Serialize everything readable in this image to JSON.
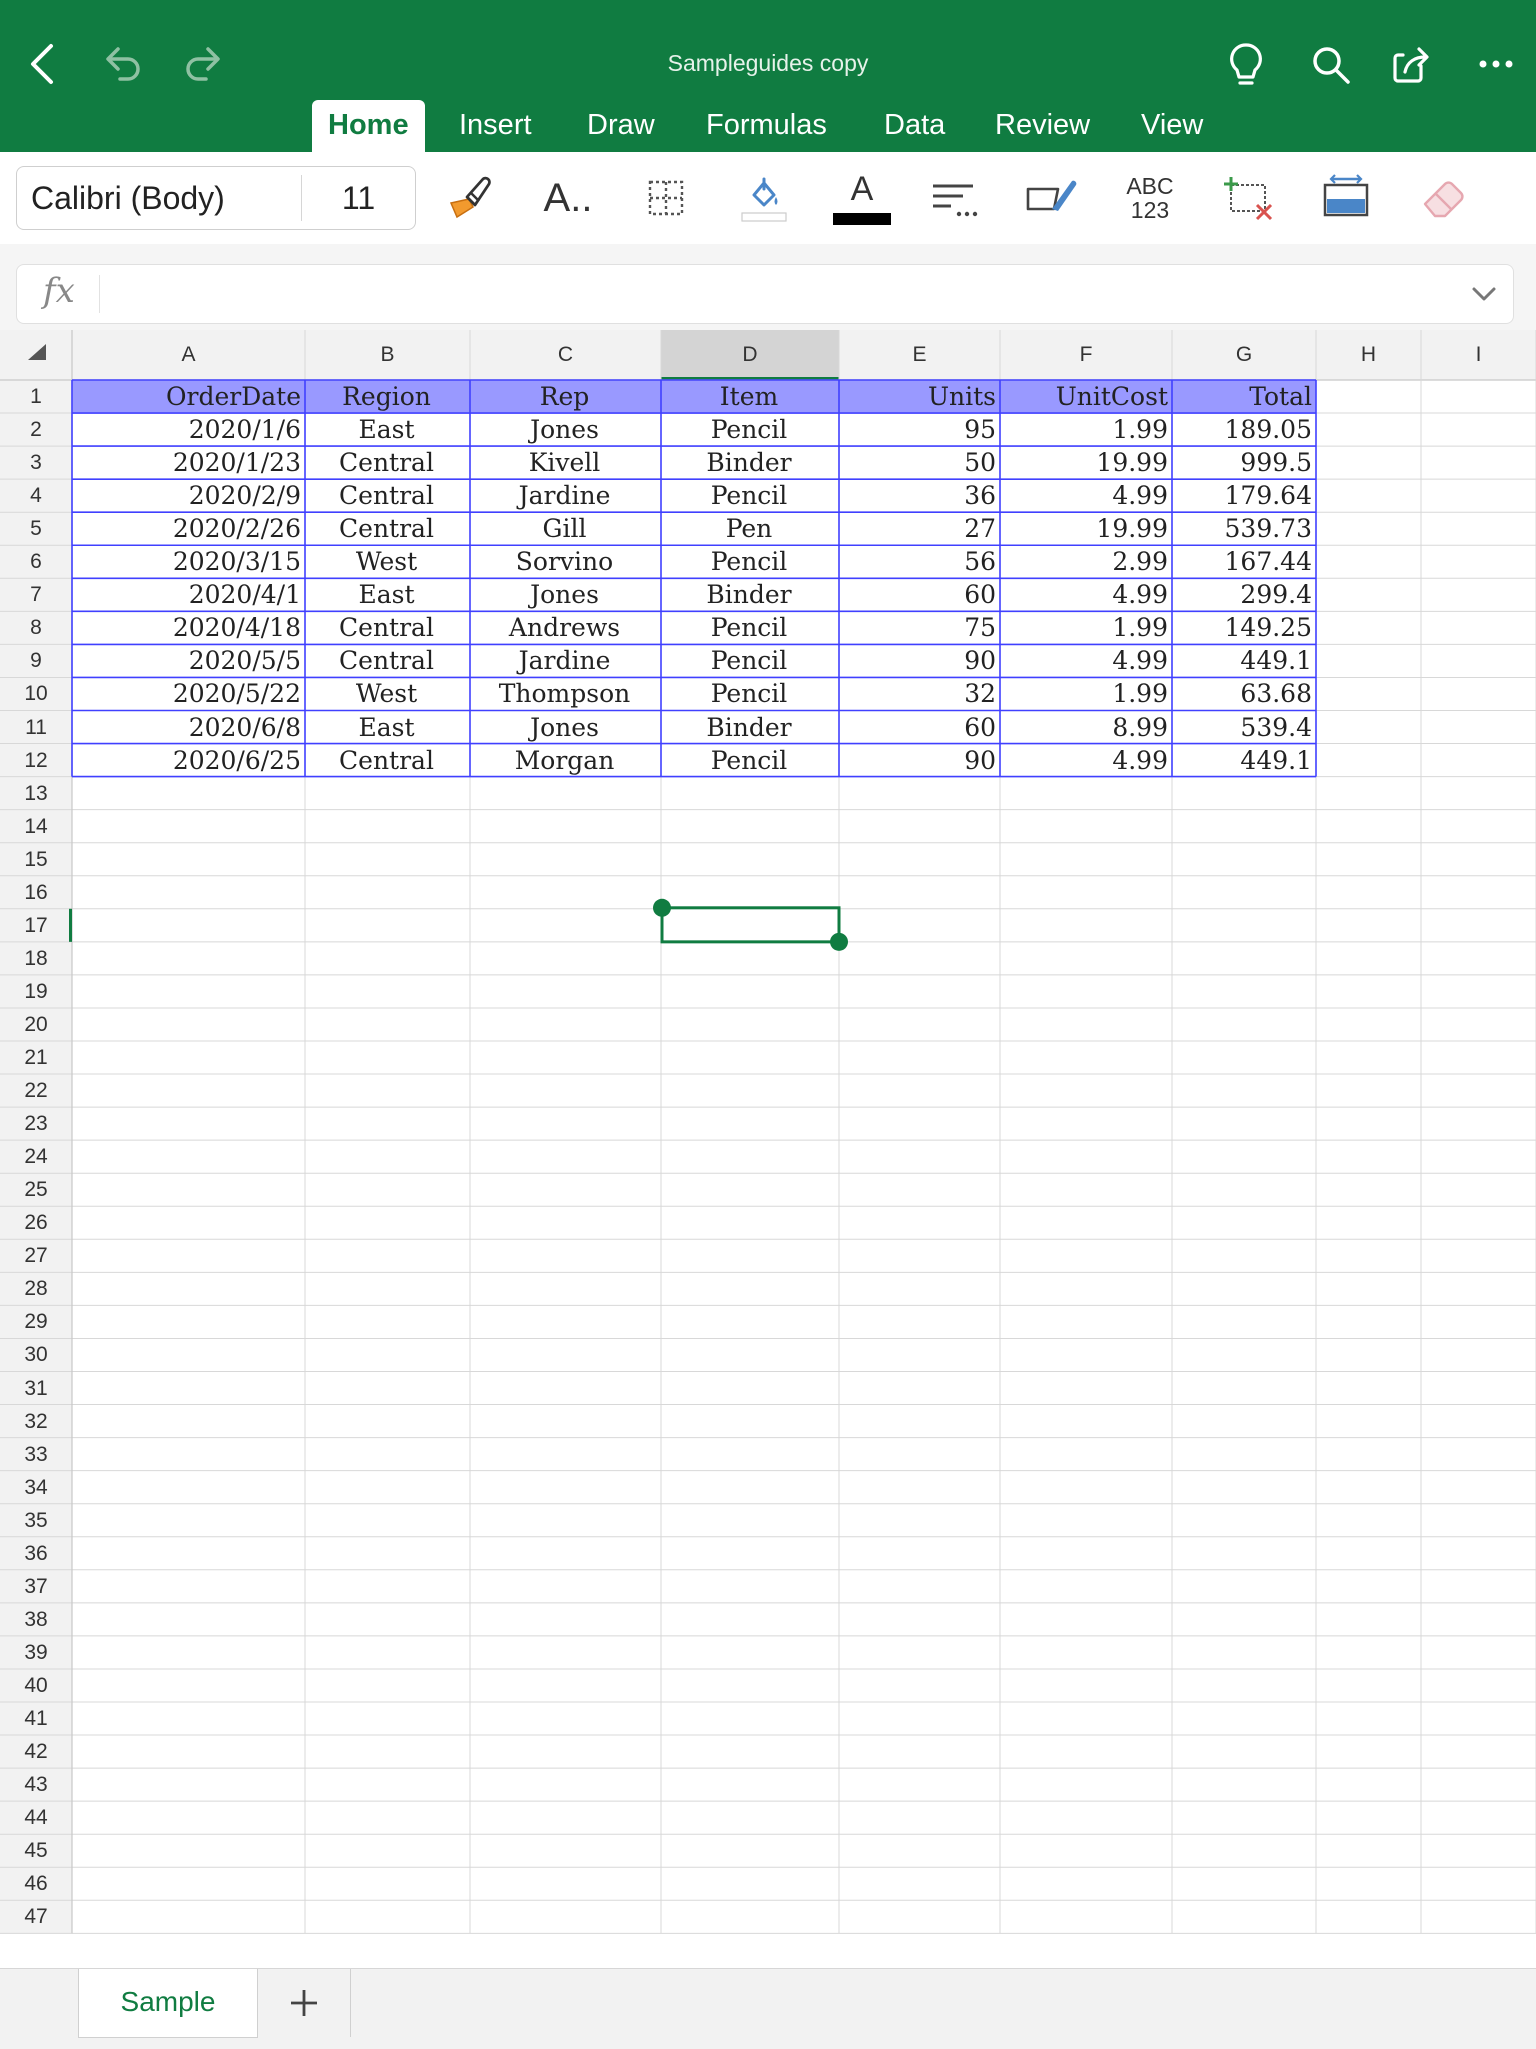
{
  "app": {
    "document_title": "Sampleguides copy",
    "accent_color": "#107c41"
  },
  "toolbar_icons": [
    "back-icon",
    "undo-icon",
    "redo-icon",
    "lightbulb-icon",
    "search-icon",
    "share-icon",
    "more-icon"
  ],
  "tabs": [
    {
      "label": "Home",
      "active": true
    },
    {
      "label": "Insert",
      "active": false
    },
    {
      "label": "Draw",
      "active": false
    },
    {
      "label": "Formulas",
      "active": false
    },
    {
      "label": "Data",
      "active": false
    },
    {
      "label": "Review",
      "active": false
    },
    {
      "label": "View",
      "active": false
    }
  ],
  "ribbon": {
    "font_name": "Calibri (Body)",
    "font_size": "11",
    "number_format_label_top": "ABC",
    "number_format_label_bottom": "123",
    "font_color_glyph": "A",
    "font_style_glyph": "A..",
    "icons": [
      "format-painter-icon",
      "font-style-icon",
      "borders-icon",
      "fill-color-icon",
      "font-color-icon",
      "alignment-icon",
      "cell-styles-icon",
      "number-format-icon",
      "insert-delete-icon",
      "format-cells-icon",
      "clear-icon"
    ]
  },
  "formula_bar": {
    "fx_label": "fx",
    "value": ""
  },
  "grid": {
    "columns": [
      "A",
      "B",
      "C",
      "D",
      "E",
      "F",
      "G",
      "H",
      "I"
    ],
    "row_numbers": [
      "1",
      "2",
      "3",
      "4",
      "5",
      "6",
      "7",
      "8",
      "9",
      "10",
      "11",
      "12",
      "13",
      "14",
      "15",
      "16",
      "17",
      "18",
      "19",
      "20",
      "21",
      "22",
      "23",
      "24",
      "25",
      "26",
      "27",
      "28",
      "29",
      "30",
      "31",
      "32",
      "33",
      "34",
      "35",
      "36",
      "37",
      "38",
      "39",
      "40",
      "41",
      "42",
      "43",
      "44",
      "45",
      "46",
      "47"
    ],
    "selected_column": "D",
    "selected_row": "17",
    "selected_cell": "D17",
    "table_header_color": "#9999ff",
    "table_border_color": "#4040ff",
    "headers": [
      "OrderDate",
      "Region",
      "Rep",
      "Item",
      "Units",
      "UnitCost",
      "Total"
    ],
    "rows": [
      [
        "2020/1/6",
        "East",
        "Jones",
        "Pencil",
        "95",
        "1.99",
        "189.05"
      ],
      [
        "2020/1/23",
        "Central",
        "Kivell",
        "Binder",
        "50",
        "19.99",
        "999.5"
      ],
      [
        "2020/2/9",
        "Central",
        "Jardine",
        "Pencil",
        "36",
        "4.99",
        "179.64"
      ],
      [
        "2020/2/26",
        "Central",
        "Gill",
        "Pen",
        "27",
        "19.99",
        "539.73"
      ],
      [
        "2020/3/15",
        "West",
        "Sorvino",
        "Pencil",
        "56",
        "2.99",
        "167.44"
      ],
      [
        "2020/4/1",
        "East",
        "Jones",
        "Binder",
        "60",
        "4.99",
        "299.4"
      ],
      [
        "2020/4/18",
        "Central",
        "Andrews",
        "Pencil",
        "75",
        "1.99",
        "149.25"
      ],
      [
        "2020/5/5",
        "Central",
        "Jardine",
        "Pencil",
        "90",
        "4.99",
        "449.1"
      ],
      [
        "2020/5/22",
        "West",
        "Thompson",
        "Pencil",
        "32",
        "1.99",
        "63.68"
      ],
      [
        "2020/6/8",
        "East",
        "Jones",
        "Binder",
        "60",
        "8.99",
        "539.4"
      ],
      [
        "2020/6/25",
        "Central",
        "Morgan",
        "Pencil",
        "90",
        "4.99",
        "449.1"
      ]
    ]
  },
  "sheets": {
    "tabs": [
      "Sample"
    ],
    "add_icon": "plus-icon"
  }
}
